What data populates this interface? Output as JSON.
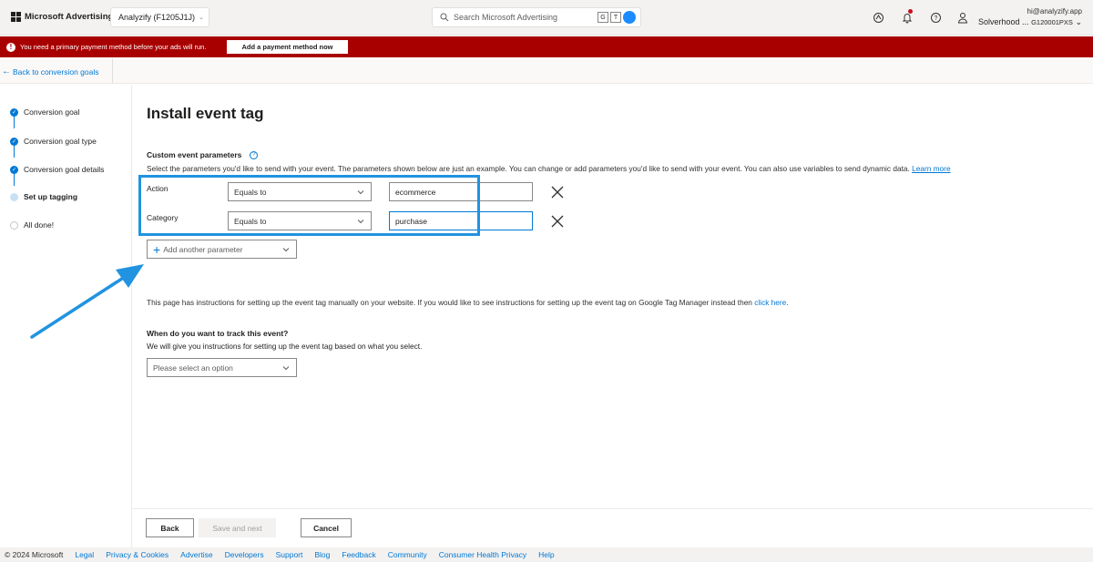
{
  "header": {
    "brand": "Microsoft Advertising",
    "account": "Analyzify (F1205J1J)",
    "search_placeholder": "Search Microsoft Advertising",
    "ext_g": "G",
    "ext_t": "T",
    "user_email": "hi@analyzify.app",
    "user_account_name": "Solverhood ...",
    "user_account_id": "G120001PXS"
  },
  "banner": {
    "message": "You need a primary payment method before your ads will run.",
    "button": "Add a payment method now"
  },
  "nav": {
    "back": "Back to conversion goals"
  },
  "steps": [
    {
      "label": "Conversion goal",
      "state": "done"
    },
    {
      "label": "Conversion goal type",
      "state": "done"
    },
    {
      "label": "Conversion goal details",
      "state": "done"
    },
    {
      "label": "Set up tagging",
      "state": "current"
    },
    {
      "label": "All done!",
      "state": "pending"
    }
  ],
  "main": {
    "title": "Install event tag",
    "section_label": "Custom event parameters",
    "help": "?",
    "description": "Select the parameters you'd like to send with your event. The parameters shown below are just an example. You can change or add parameters you'd like to send with your event. You can also use variables to send dynamic data.",
    "learn_more": "Learn more",
    "params": [
      {
        "name": "Action",
        "operator": "Equals to",
        "value": "ecommerce"
      },
      {
        "name": "Category",
        "operator": "Equals to",
        "value": "purchase"
      }
    ],
    "add_param": "Add another parameter",
    "info_text": "This page has instructions for setting up the event tag manually on your website. If you would like to see instructions for setting up the event tag on Google Tag Manager instead then",
    "info_link": "click here",
    "info_end": ".",
    "question_title": "When do you want to track this event?",
    "question_desc": "We will give you instructions for setting up the event tag based on what you select.",
    "select_placeholder": "Please select an option"
  },
  "actions": {
    "back": "Back",
    "save_next": "Save and next",
    "cancel": "Cancel"
  },
  "footer": {
    "copyright": "© 2024 Microsoft",
    "links": [
      "Legal",
      "Privacy & Cookies",
      "Advertise",
      "Developers",
      "Support",
      "Blog",
      "Feedback",
      "Community",
      "Consumer Health Privacy",
      "Help"
    ]
  },
  "colors": {
    "accent": "#0078d4",
    "banner": "#a80000",
    "annotation": "#2193e0"
  }
}
